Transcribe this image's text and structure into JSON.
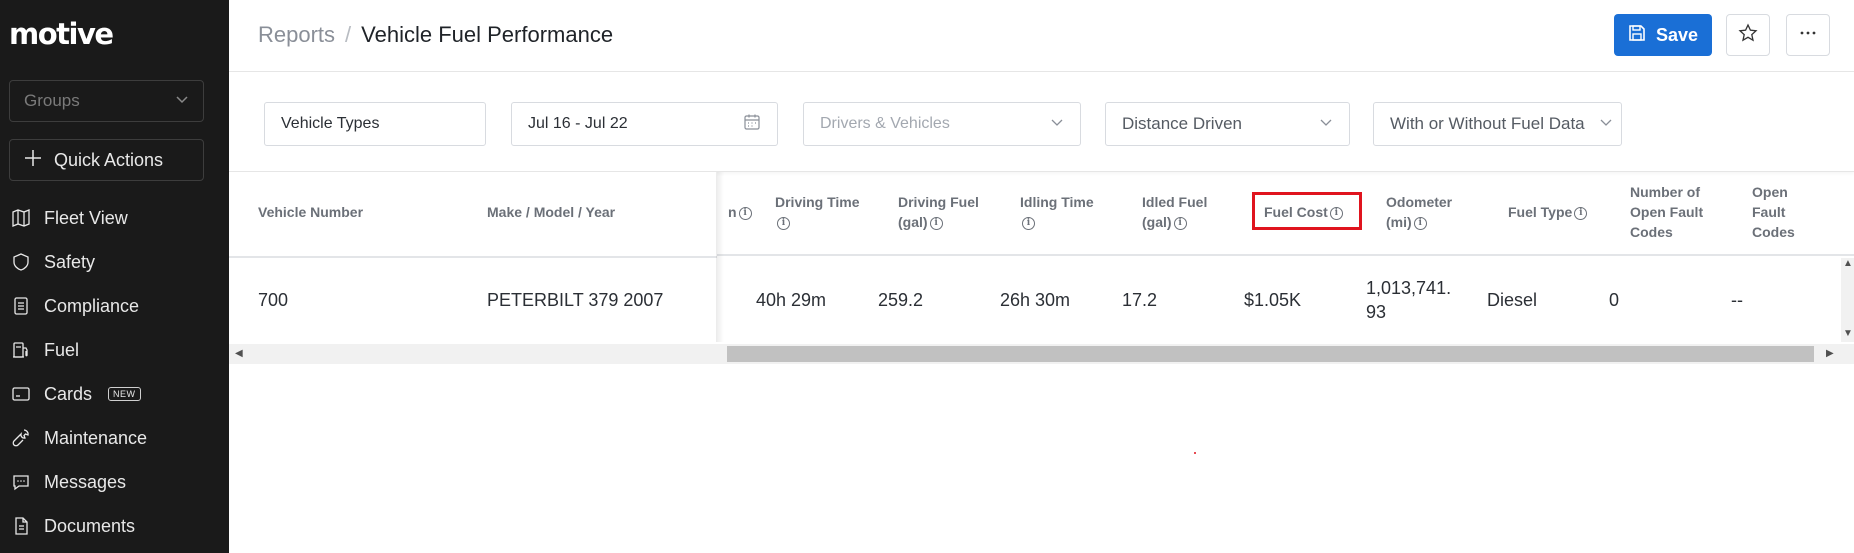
{
  "sidebar": {
    "logo": "motive",
    "groups_placeholder": "Groups",
    "quick_actions": "Quick Actions",
    "items": [
      {
        "label": "Fleet View",
        "icon": "map-icon"
      },
      {
        "label": "Safety",
        "icon": "shield-icon"
      },
      {
        "label": "Compliance",
        "icon": "document-list-icon"
      },
      {
        "label": "Fuel",
        "icon": "fuel-pump-icon"
      },
      {
        "label": "Cards",
        "icon": "card-icon",
        "badge": "NEW"
      },
      {
        "label": "Maintenance",
        "icon": "wrench-icon"
      },
      {
        "label": "Messages",
        "icon": "chat-icon"
      },
      {
        "label": "Documents",
        "icon": "document-icon"
      }
    ]
  },
  "header": {
    "breadcrumb_parent": "Reports",
    "breadcrumb_separator": "/",
    "title": "Vehicle Fuel Performance",
    "save_label": "Save",
    "save_color": "#1a6fd6"
  },
  "filters": {
    "vehicle_types": "Vehicle Types",
    "date_range": "Jul 16 - Jul 22",
    "drivers_vehicles": "Drivers & Vehicles",
    "distance": "Distance Driven",
    "fuel_data": "With or Without Fuel Data"
  },
  "table": {
    "headers": {
      "vehicle_number": "Vehicle Number",
      "make_model_year": "Make / Model / Year",
      "truncated": "n",
      "driving_time": [
        "Driving Time"
      ],
      "driving_fuel": [
        "Driving Fuel",
        "(gal)"
      ],
      "idling_time": [
        "Idling Time"
      ],
      "idled_fuel": [
        "Idled Fuel",
        "(gal)"
      ],
      "fuel_cost": "Fuel Cost",
      "odometer": [
        "Odometer",
        "(mi)"
      ],
      "fuel_type": "Fuel Type",
      "open_fault_codes_count": [
        "Number of",
        "Open Fault",
        "Codes"
      ],
      "open_fault_codes": [
        "Open",
        "Fault",
        "Codes"
      ]
    },
    "rows": [
      {
        "vehicle_number": "700",
        "make_model_year": "PETERBILT 379 2007",
        "driving_time": "40h 29m",
        "driving_fuel": "259.2",
        "idling_time": "26h 30m",
        "idled_fuel": "17.2",
        "fuel_cost": "$1.05K",
        "odometer": [
          "1,013,741.",
          "93"
        ],
        "fuel_type": "Diesel",
        "open_fault_codes_count": "0",
        "open_fault_codes": "--"
      }
    ],
    "highlight_color": "#e0141e"
  }
}
